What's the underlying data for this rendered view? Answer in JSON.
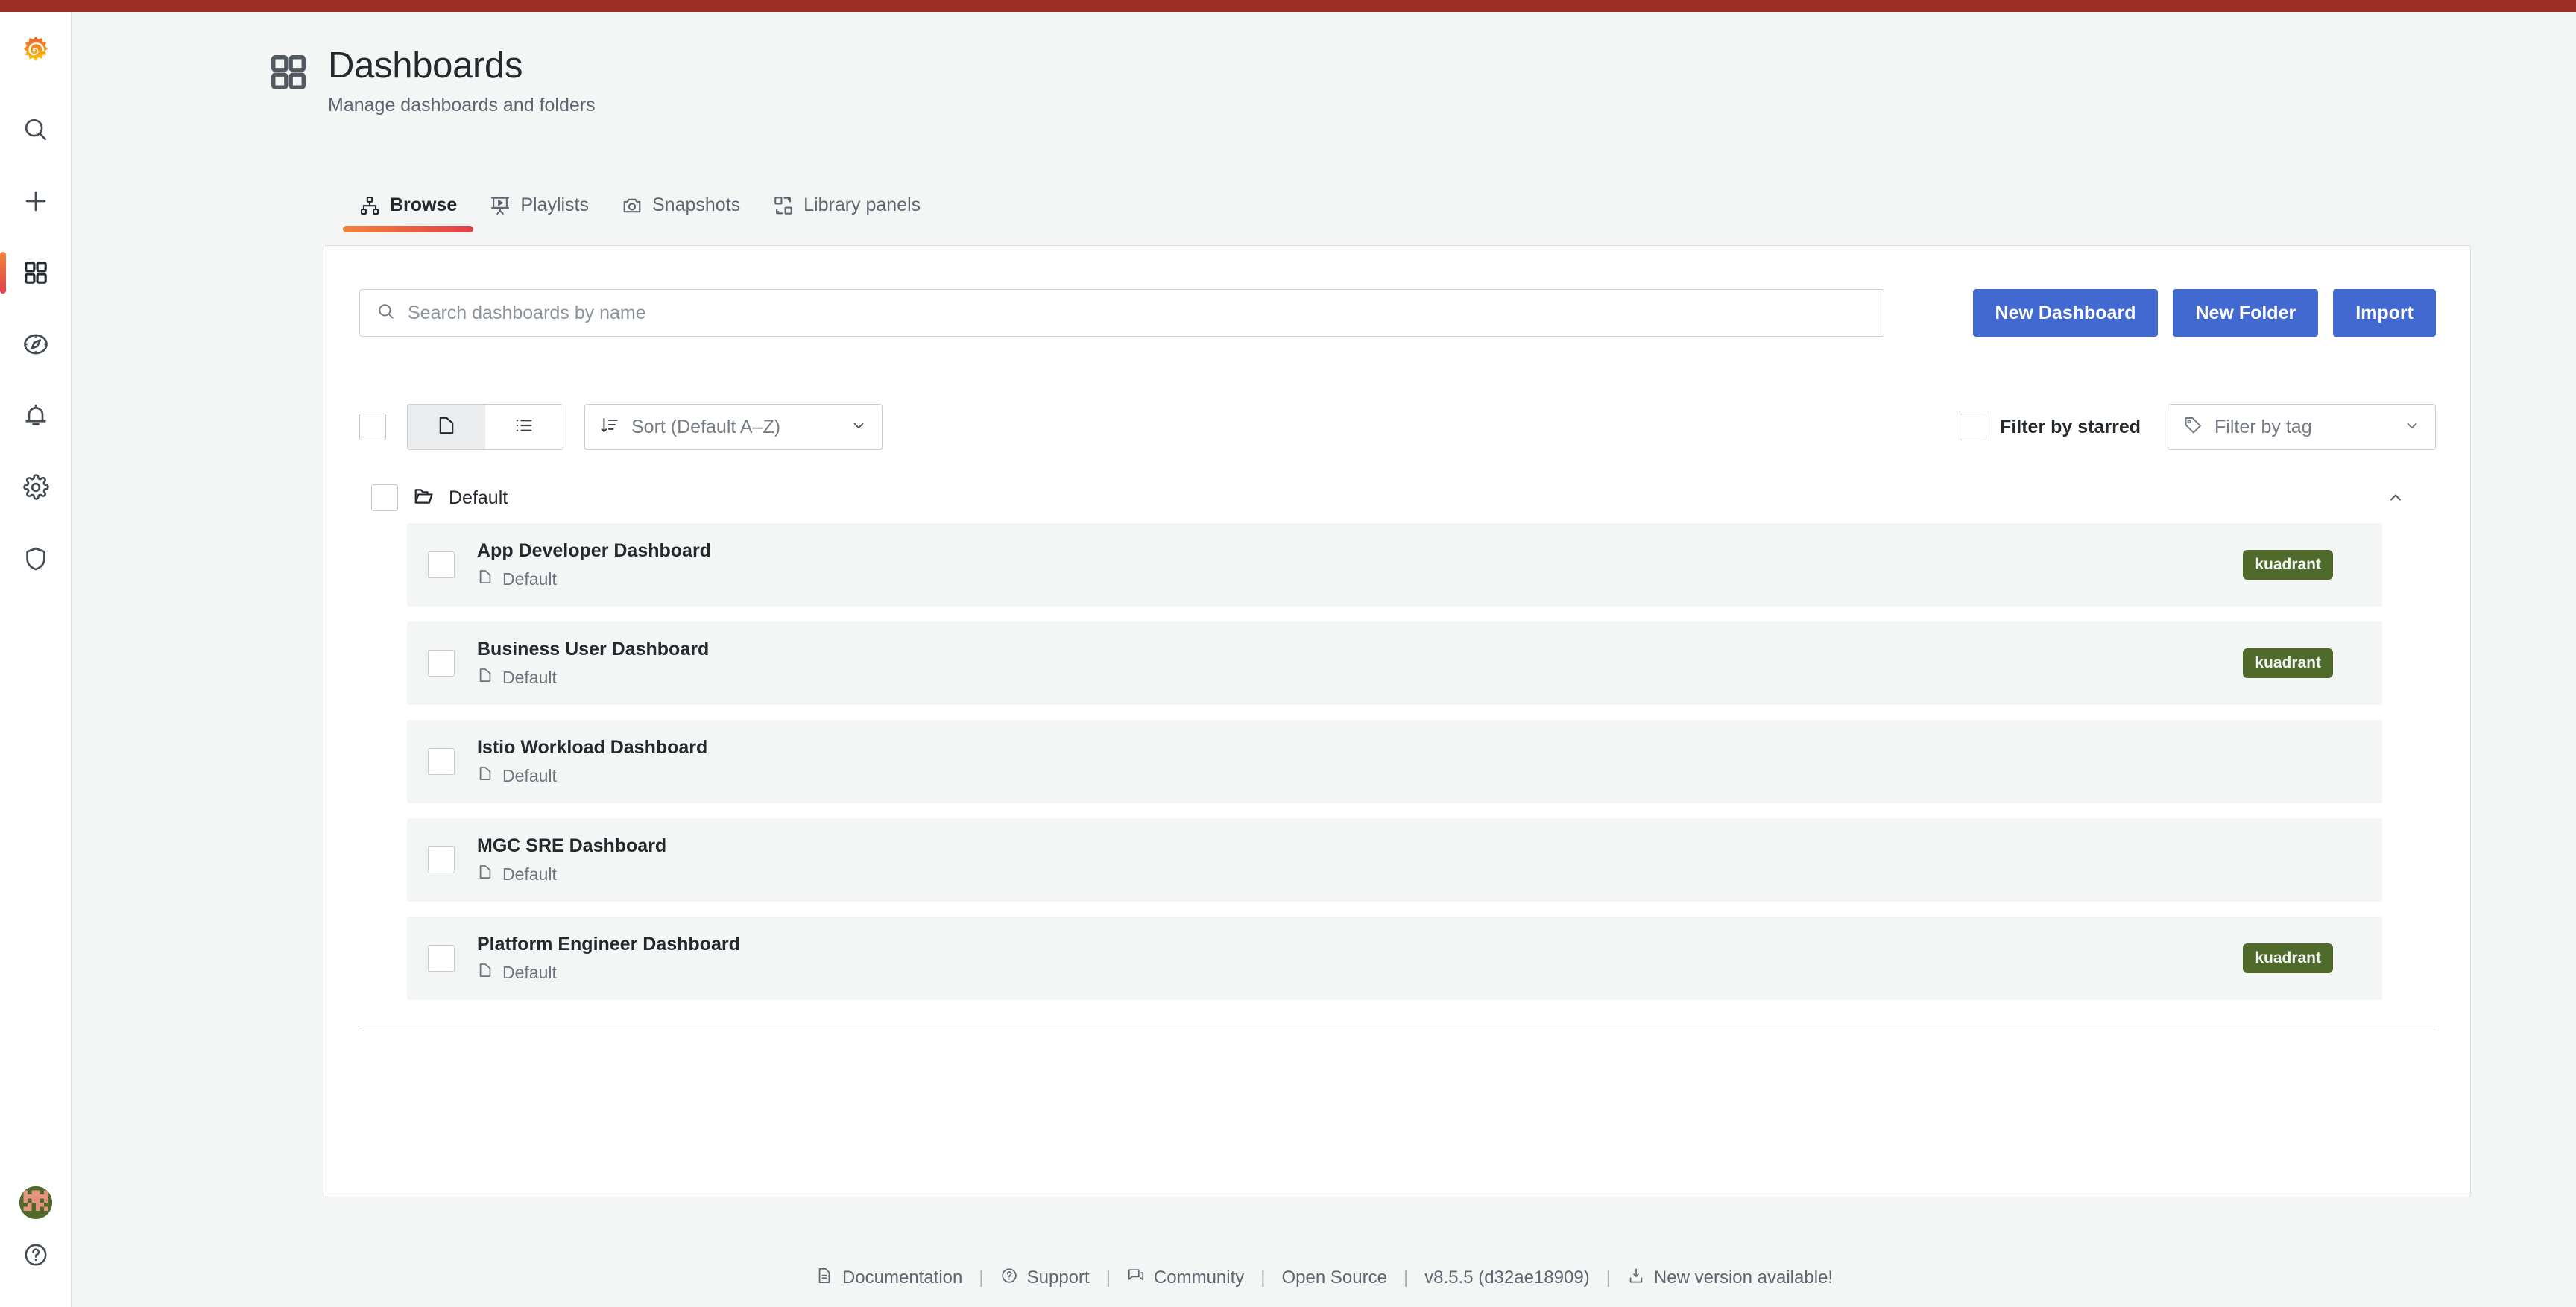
{
  "theme": {
    "accent_red": "#9B2D24",
    "brand_gradient_from": "#F2843A",
    "brand_gradient_to": "#E0404A",
    "primary_button": "#4269D0",
    "tag_green": "#4F6A2B",
    "page_background": "#F4F5F5"
  },
  "sidebar": {
    "logo": "grafana-logo",
    "items": [
      {
        "name": "search",
        "icon": "search-icon",
        "active": false
      },
      {
        "name": "create",
        "icon": "plus-icon",
        "active": false
      },
      {
        "name": "dashboards",
        "icon": "dashboards-icon",
        "active": true
      },
      {
        "name": "explore",
        "icon": "compass-icon",
        "active": false
      },
      {
        "name": "alerting",
        "icon": "bell-icon",
        "active": false
      },
      {
        "name": "configuration",
        "icon": "gear-icon",
        "active": false
      },
      {
        "name": "server-admin",
        "icon": "shield-icon",
        "active": false
      }
    ],
    "bottom": [
      {
        "name": "user-avatar",
        "icon": "avatar-identicon"
      },
      {
        "name": "help",
        "icon": "question-circle-icon"
      }
    ]
  },
  "header": {
    "icon": "dashboards-grid-icon",
    "title": "Dashboards",
    "subtitle": "Manage dashboards and folders"
  },
  "tabs": [
    {
      "label": "Browse",
      "icon": "sitemap-icon",
      "active": true
    },
    {
      "label": "Playlists",
      "icon": "presentation-play-icon",
      "active": false
    },
    {
      "label": "Snapshots",
      "icon": "camera-icon",
      "active": false
    },
    {
      "label": "Library panels",
      "icon": "library-panels-icon",
      "active": false
    }
  ],
  "search": {
    "icon": "search-icon",
    "value": "",
    "placeholder": "Search dashboards by name"
  },
  "actions": {
    "new_dashboard": "New Dashboard",
    "new_folder": "New Folder",
    "import": "Import"
  },
  "filters": {
    "select_all_checked": false,
    "view_toggle": {
      "folder_view": {
        "icon": "folder-icon",
        "selected": true
      },
      "list_view": {
        "icon": "list-icon",
        "selected": false
      }
    },
    "sort": {
      "icon": "sort-amount-down-icon",
      "value": "Sort (Default A–Z)",
      "caret": "chevron-down-icon"
    },
    "starred": {
      "label": "Filter by starred",
      "checked": false
    },
    "tag": {
      "icon": "tag-icon",
      "placeholder": "Filter by tag",
      "value": "",
      "caret": "chevron-down-icon"
    }
  },
  "list": {
    "folder": {
      "icon": "folder-open-icon",
      "name": "Default",
      "checked": false,
      "collapse_icon": "chevron-up-icon",
      "expanded": true
    },
    "rows": [
      {
        "title": "App Developer Dashboard",
        "folder": "Default",
        "folder_icon": "folder-icon",
        "checked": false,
        "tags": [
          "kuadrant"
        ]
      },
      {
        "title": "Business User Dashboard",
        "folder": "Default",
        "folder_icon": "folder-icon",
        "checked": false,
        "tags": [
          "kuadrant"
        ]
      },
      {
        "title": "Istio Workload Dashboard",
        "folder": "Default",
        "folder_icon": "folder-icon",
        "checked": false,
        "tags": []
      },
      {
        "title": "MGC SRE Dashboard",
        "folder": "Default",
        "folder_icon": "folder-icon",
        "checked": false,
        "tags": []
      },
      {
        "title": "Platform Engineer Dashboard",
        "folder": "Default",
        "folder_icon": "folder-icon",
        "checked": false,
        "tags": [
          "kuadrant"
        ]
      }
    ]
  },
  "footer": {
    "items": [
      {
        "label": "Documentation",
        "icon": "document-info-icon",
        "link": true
      },
      {
        "label": "Support",
        "icon": "question-circle-icon",
        "link": true
      },
      {
        "label": "Community",
        "icon": "comments-icon",
        "link": true
      },
      {
        "label": "Open Source",
        "icon": "",
        "link": true
      },
      {
        "label": "v8.5.5 (d32ae18909)",
        "icon": "",
        "link": false
      },
      {
        "label": "New version available!",
        "icon": "download-icon",
        "link": true
      }
    ],
    "separator": "|"
  }
}
